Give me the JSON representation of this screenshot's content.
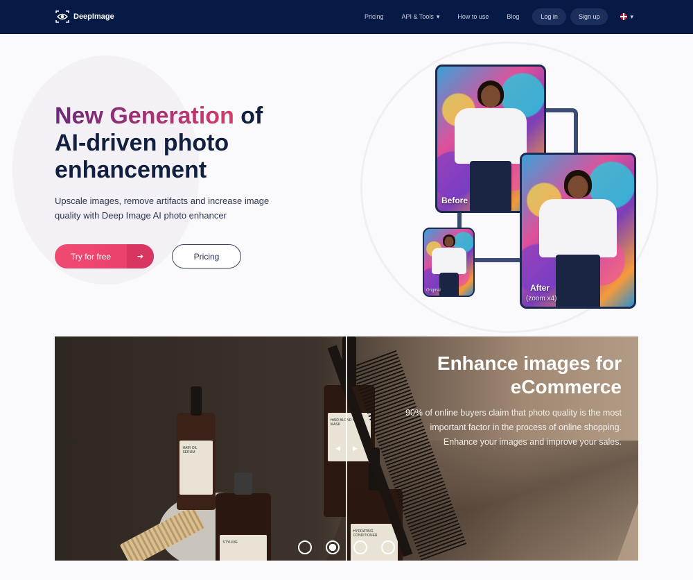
{
  "nav": {
    "brand": "DeepImage",
    "links": [
      {
        "label": "Pricing"
      },
      {
        "label": "API & Tools",
        "chevron": "▾"
      },
      {
        "label": "How to use"
      },
      {
        "label": "Blog"
      }
    ],
    "login": "Log in",
    "signup": "Sign up",
    "lang_chevron": "▾"
  },
  "hero": {
    "title_gradient": "New Generation",
    "title_rest_1": " of",
    "title_rest_2": "AI-driven photo enhancement",
    "subtitle": "Upscale images, remove artifacts and increase image quality with Deep Image AI photo enhancer",
    "try_label": "Try for free",
    "try_arrow": "➔",
    "pricing_label": "Pricing"
  },
  "cards": {
    "before": "Before",
    "after": "After",
    "after_sub": "(zoom x4)",
    "original": "Original"
  },
  "banner": {
    "title": "Enhance images for eCommerce",
    "text": "90% of online buyers claim that photo quality is the most important factor in the process of online shopping. Enhance your images and improve your sales.",
    "handle_left": "◀",
    "handle_right": "▶",
    "bottle_labels": [
      "HAIR OIL SERUM",
      "HAIR BLOND HAIR MASK",
      "HYDRATING CONDITIONER",
      "STYLING"
    ]
  },
  "carousel": {
    "count": 4,
    "active": 2
  },
  "colors": {
    "nav_bg": "#051a45",
    "accent_pink": "#f04a72",
    "accent_purple": "#6a2a78",
    "dark_text": "#11203f"
  }
}
